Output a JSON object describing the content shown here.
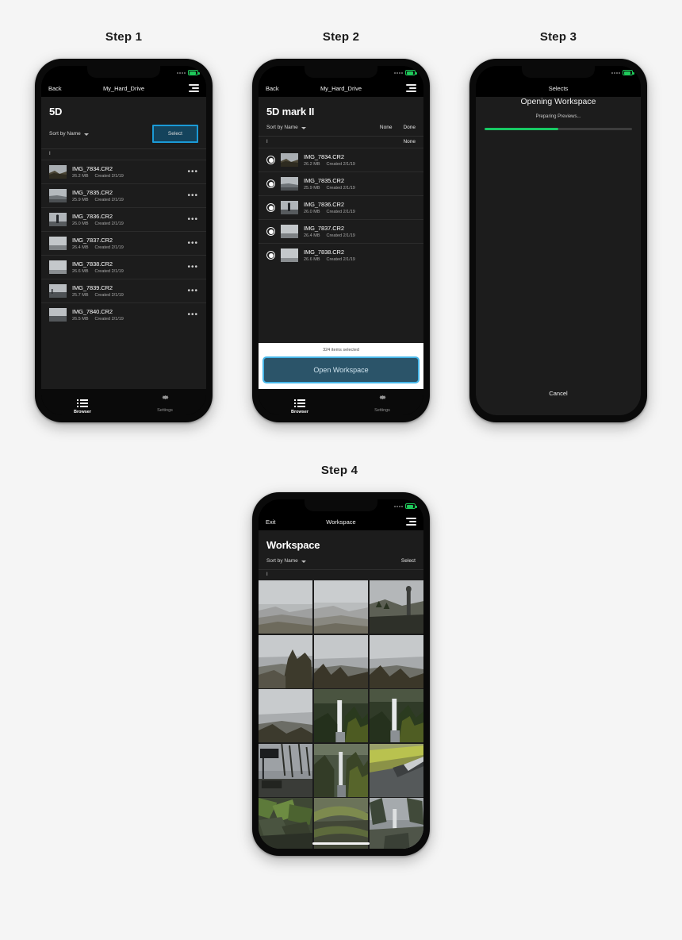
{
  "page": {
    "background": "#f5f5f5"
  },
  "steps": [
    {
      "label": "Step 1"
    },
    {
      "label": "Step 2"
    },
    {
      "label": "Step 3"
    },
    {
      "label": "Step 4"
    }
  ],
  "colors": {
    "accent_highlight": "#1b9ad6",
    "select_fill": "#14435c",
    "open_ws_fill": "#2b5469",
    "open_ws_border": "#46b6e8",
    "progress_green": "#17c964",
    "battery_green": "#1ec95a",
    "screen_bg": "#1c1c1c",
    "bar_bg": "#000000"
  },
  "step1": {
    "nav": {
      "back_label": "Back",
      "title": "My_Hard_Drive",
      "menu_icon": "hamburger-menu-icon"
    },
    "page_title": "5D",
    "toolbar": {
      "sort_label": "Sort by Name",
      "sort_chevron_icon": "chevron-down-icon",
      "select_label": "Select"
    },
    "section_header": "I",
    "files": [
      {
        "name": "IMG_7834.CR2",
        "size": "26.2 MB",
        "created": "Created 2/1/19"
      },
      {
        "name": "IMG_7835.CR2",
        "size": "25.9 MB",
        "created": "Created 2/1/19"
      },
      {
        "name": "IMG_7836.CR2",
        "size": "26.0 MB",
        "created": "Created 2/1/19"
      },
      {
        "name": "IMG_7837.CR2",
        "size": "26.4 MB",
        "created": "Created 2/1/19"
      },
      {
        "name": "IMG_7838.CR2",
        "size": "26.6 MB",
        "created": "Created 2/1/19"
      },
      {
        "name": "IMG_7839.CR2",
        "size": "25.7 MB",
        "created": "Created 2/1/19"
      },
      {
        "name": "IMG_7840.CR2",
        "size": "26.5 MB",
        "created": "Created 2/1/19"
      }
    ],
    "row_menu_icon": "more-options-icon",
    "tabs": [
      {
        "label": "Browser",
        "icon": "list-icon",
        "active": true
      },
      {
        "label": "Settings",
        "icon": "gear-icon",
        "active": false
      }
    ]
  },
  "step2": {
    "nav": {
      "back_label": "Back",
      "title": "My_Hard_Drive",
      "menu_icon": "hamburger-menu-icon"
    },
    "page_title": "5D mark II",
    "toolbar": {
      "sort_label": "Sort by Name",
      "none_label": "None",
      "done_label": "Done"
    },
    "section_header": "I",
    "section_action": "None",
    "files": [
      {
        "name": "IMG_7834.CR2",
        "size": "26.2 MB",
        "created": "Created 2/1/19",
        "selected": true
      },
      {
        "name": "IMG_7835.CR2",
        "size": "25.9 MB",
        "created": "Created 2/1/19",
        "selected": true
      },
      {
        "name": "IMG_7836.CR2",
        "size": "26.0 MB",
        "created": "Created 2/1/19",
        "selected": true
      },
      {
        "name": "IMG_7837.CR2",
        "size": "26.4 MB",
        "created": "Created 2/1/19",
        "selected": true
      },
      {
        "name": "IMG_7838.CR2",
        "size": "26.6 MB",
        "created": "Created 2/1/19",
        "selected": true
      }
    ],
    "action_panel": {
      "count_label": "324 items selected",
      "button_label": "Open Workspace"
    },
    "tabs": [
      {
        "label": "Browser",
        "icon": "list-icon",
        "active": true
      },
      {
        "label": "Settings",
        "icon": "gear-icon",
        "active": false
      }
    ]
  },
  "step3": {
    "nav": {
      "title": "Selects"
    },
    "loading": {
      "title": "Opening Workspace",
      "subtitle": "Preparing Previews...",
      "progress_percent": 50
    },
    "cancel_label": "Cancel"
  },
  "step4": {
    "nav": {
      "exit_label": "Exit",
      "title": "Workspace",
      "menu_icon": "hamburger-menu-icon"
    },
    "page_title": "Workspace",
    "toolbar": {
      "sort_label": "Sort by Name",
      "select_label": "Select"
    },
    "section_header": "I",
    "thumbnails": [
      {
        "caption": "foggy-river-valley"
      },
      {
        "caption": "foggy-river-valley"
      },
      {
        "caption": "vista-house-cliff"
      },
      {
        "caption": "cliff-road-overlook"
      },
      {
        "caption": "cliff-road-overlook"
      },
      {
        "caption": "cliff-road-overlook"
      },
      {
        "caption": "cliff-road-overlook"
      },
      {
        "caption": "multnomah-falls"
      },
      {
        "caption": "multnomah-falls"
      },
      {
        "caption": "bare-trees-parking"
      },
      {
        "caption": "forest-waterfall"
      },
      {
        "caption": "mossy-stone-wall-road"
      },
      {
        "caption": "mossy-ground-plants"
      },
      {
        "caption": "mossy-bridge-arch"
      },
      {
        "caption": "misty-forest-path"
      }
    ]
  }
}
